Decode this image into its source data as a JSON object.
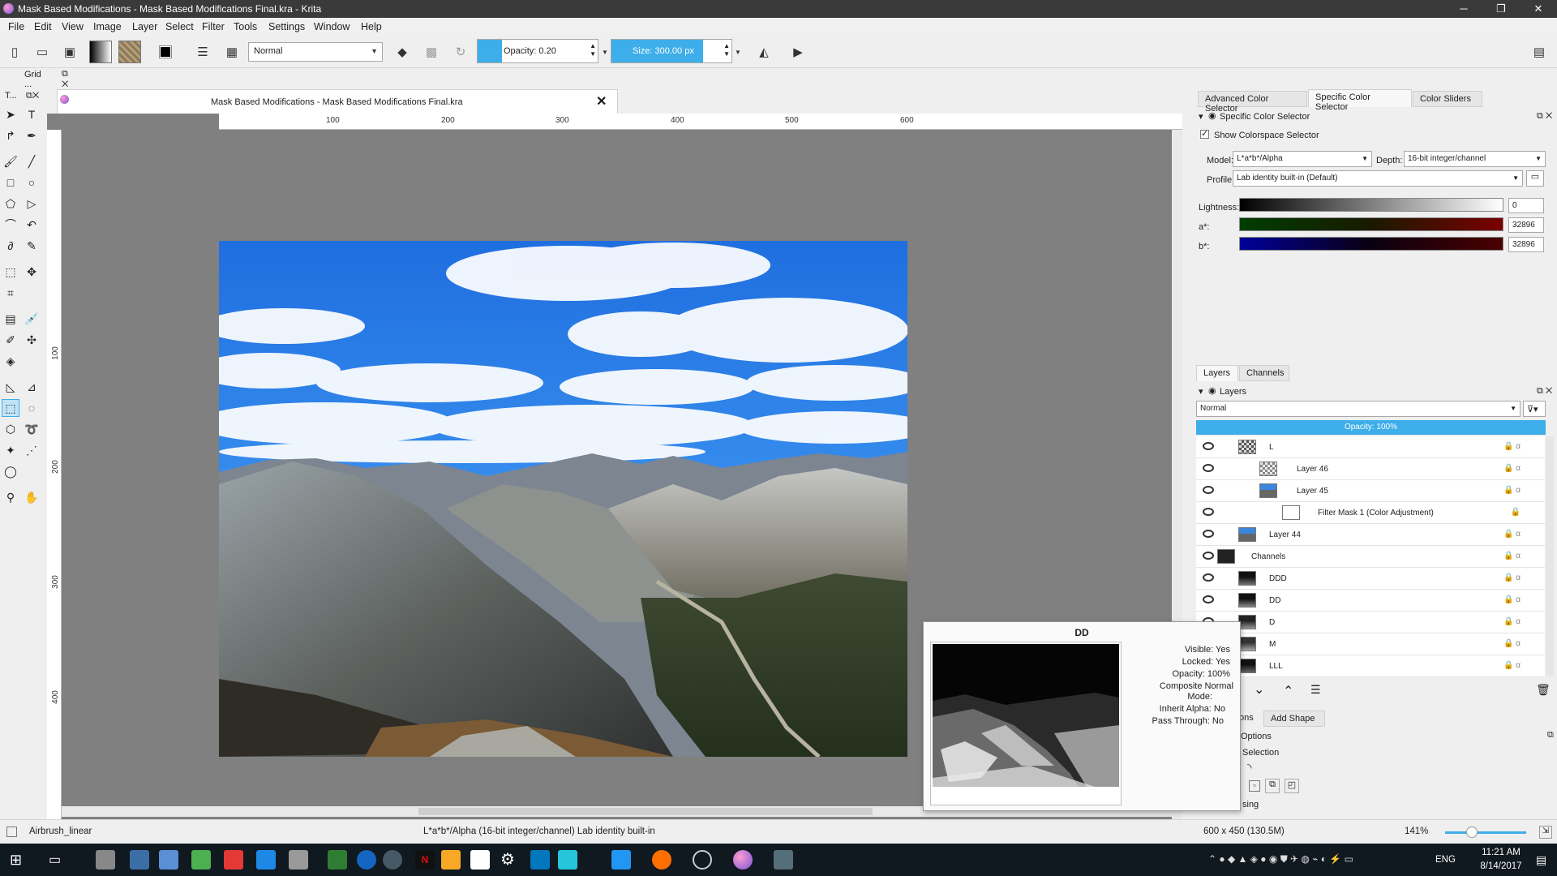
{
  "window": {
    "title": "Mask Based Modifications - Mask Based Modifications Final.kra - Krita",
    "minimize": "─",
    "restore": "❐",
    "close": "✕"
  },
  "menu": [
    "File",
    "Edit",
    "View",
    "Image",
    "Layer",
    "Select",
    "Filter",
    "Tools",
    "Settings",
    "Window",
    "Help"
  ],
  "toolbar": {
    "blend_mode": "Normal",
    "opacity_label": "Opacity: 0.20",
    "opacity_fraction": 0.2,
    "size_label": "Size:  300.00 px",
    "size_fill_fraction": 0.75
  },
  "toolbox": {
    "header": "T...",
    "grid_docker": "Grid ..."
  },
  "document": {
    "tab_title": "Mask Based Modifications - Mask Based Modifications Final.kra",
    "ruler_top": [
      "100",
      "200",
      "300",
      "400",
      "500",
      "600"
    ],
    "ruler_left": [
      "100",
      "200",
      "300",
      "400"
    ]
  },
  "color_selector": {
    "tabs": [
      "Advanced Color Selector",
      "Specific Color Selector",
      "Color Sliders"
    ],
    "docker_title": "Specific Color Selector",
    "show_colorspace": "Show Colorspace Selector",
    "model_label": "Model:",
    "model_value": "L*a*b*/Alpha",
    "depth_label": "Depth:",
    "depth_value": "16-bit integer/channel",
    "profile_label": "Profile:",
    "profile_value": "Lab identity built-in (Default)",
    "channels": [
      {
        "label": "Lightness:",
        "value": "0"
      },
      {
        "label": "a*:",
        "value": "32896"
      },
      {
        "label": "b*:",
        "value": "32896"
      }
    ]
  },
  "layers": {
    "tabs": [
      "Layers",
      "Channels"
    ],
    "docker_title": "Layers",
    "blend_mode": "Normal",
    "opacity_label": "Opacity:  100%",
    "items": [
      {
        "name": "L"
      },
      {
        "name": "Layer 46"
      },
      {
        "name": "Layer 45"
      },
      {
        "name": "Filter Mask 1 (Color Adjustment)"
      },
      {
        "name": "Layer 44"
      },
      {
        "name": "Channels"
      },
      {
        "name": "DDD"
      },
      {
        "name": "DD"
      },
      {
        "name": "D"
      },
      {
        "name": "M"
      },
      {
        "name": "LLL"
      }
    ]
  },
  "tool_options": {
    "tab_partial": "ons",
    "add_shape": "Add Shape",
    "options_partial": "Options",
    "selection": "Selection",
    "alias_partial": "sing"
  },
  "tooltip": {
    "title": "DD",
    "visible": "Visible: Yes",
    "locked": "Locked: Yes",
    "opacity": "Opacity: 100%",
    "composite": "Composite Normal",
    "mode": "Mode:",
    "inherit": "Inherit Alpha: No",
    "pass": "Pass Through: No"
  },
  "status": {
    "brush": "Airbrush_linear",
    "colorspace": "L*a*b*/Alpha (16-bit integer/channel)  Lab identity built-in",
    "size": "600 x 450 (130.5M)",
    "zoom": "141%"
  },
  "taskbar": {
    "time": "11:21 AM",
    "date": "8/14/2017",
    "lang": "ENG"
  }
}
